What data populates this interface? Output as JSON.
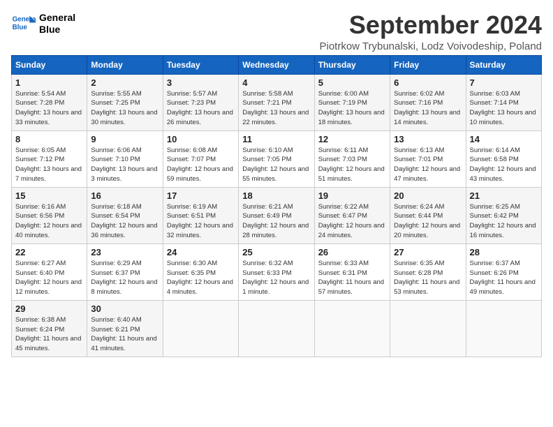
{
  "header": {
    "logo_line1": "General",
    "logo_line2": "Blue",
    "month": "September 2024",
    "location": "Piotrkow Trybunalski, Lodz Voivodeship, Poland"
  },
  "days_of_week": [
    "Sunday",
    "Monday",
    "Tuesday",
    "Wednesday",
    "Thursday",
    "Friday",
    "Saturday"
  ],
  "weeks": [
    [
      {
        "num": "1",
        "sunrise": "Sunrise: 5:54 AM",
        "sunset": "Sunset: 7:28 PM",
        "daylight": "Daylight: 13 hours and 33 minutes."
      },
      {
        "num": "2",
        "sunrise": "Sunrise: 5:55 AM",
        "sunset": "Sunset: 7:25 PM",
        "daylight": "Daylight: 13 hours and 30 minutes."
      },
      {
        "num": "3",
        "sunrise": "Sunrise: 5:57 AM",
        "sunset": "Sunset: 7:23 PM",
        "daylight": "Daylight: 13 hours and 26 minutes."
      },
      {
        "num": "4",
        "sunrise": "Sunrise: 5:58 AM",
        "sunset": "Sunset: 7:21 PM",
        "daylight": "Daylight: 13 hours and 22 minutes."
      },
      {
        "num": "5",
        "sunrise": "Sunrise: 6:00 AM",
        "sunset": "Sunset: 7:19 PM",
        "daylight": "Daylight: 13 hours and 18 minutes."
      },
      {
        "num": "6",
        "sunrise": "Sunrise: 6:02 AM",
        "sunset": "Sunset: 7:16 PM",
        "daylight": "Daylight: 13 hours and 14 minutes."
      },
      {
        "num": "7",
        "sunrise": "Sunrise: 6:03 AM",
        "sunset": "Sunset: 7:14 PM",
        "daylight": "Daylight: 13 hours and 10 minutes."
      }
    ],
    [
      {
        "num": "8",
        "sunrise": "Sunrise: 6:05 AM",
        "sunset": "Sunset: 7:12 PM",
        "daylight": "Daylight: 13 hours and 7 minutes."
      },
      {
        "num": "9",
        "sunrise": "Sunrise: 6:06 AM",
        "sunset": "Sunset: 7:10 PM",
        "daylight": "Daylight: 13 hours and 3 minutes."
      },
      {
        "num": "10",
        "sunrise": "Sunrise: 6:08 AM",
        "sunset": "Sunset: 7:07 PM",
        "daylight": "Daylight: 12 hours and 59 minutes."
      },
      {
        "num": "11",
        "sunrise": "Sunrise: 6:10 AM",
        "sunset": "Sunset: 7:05 PM",
        "daylight": "Daylight: 12 hours and 55 minutes."
      },
      {
        "num": "12",
        "sunrise": "Sunrise: 6:11 AM",
        "sunset": "Sunset: 7:03 PM",
        "daylight": "Daylight: 12 hours and 51 minutes."
      },
      {
        "num": "13",
        "sunrise": "Sunrise: 6:13 AM",
        "sunset": "Sunset: 7:01 PM",
        "daylight": "Daylight: 12 hours and 47 minutes."
      },
      {
        "num": "14",
        "sunrise": "Sunrise: 6:14 AM",
        "sunset": "Sunset: 6:58 PM",
        "daylight": "Daylight: 12 hours and 43 minutes."
      }
    ],
    [
      {
        "num": "15",
        "sunrise": "Sunrise: 6:16 AM",
        "sunset": "Sunset: 6:56 PM",
        "daylight": "Daylight: 12 hours and 40 minutes."
      },
      {
        "num": "16",
        "sunrise": "Sunrise: 6:18 AM",
        "sunset": "Sunset: 6:54 PM",
        "daylight": "Daylight: 12 hours and 36 minutes."
      },
      {
        "num": "17",
        "sunrise": "Sunrise: 6:19 AM",
        "sunset": "Sunset: 6:51 PM",
        "daylight": "Daylight: 12 hours and 32 minutes."
      },
      {
        "num": "18",
        "sunrise": "Sunrise: 6:21 AM",
        "sunset": "Sunset: 6:49 PM",
        "daylight": "Daylight: 12 hours and 28 minutes."
      },
      {
        "num": "19",
        "sunrise": "Sunrise: 6:22 AM",
        "sunset": "Sunset: 6:47 PM",
        "daylight": "Daylight: 12 hours and 24 minutes."
      },
      {
        "num": "20",
        "sunrise": "Sunrise: 6:24 AM",
        "sunset": "Sunset: 6:44 PM",
        "daylight": "Daylight: 12 hours and 20 minutes."
      },
      {
        "num": "21",
        "sunrise": "Sunrise: 6:25 AM",
        "sunset": "Sunset: 6:42 PM",
        "daylight": "Daylight: 12 hours and 16 minutes."
      }
    ],
    [
      {
        "num": "22",
        "sunrise": "Sunrise: 6:27 AM",
        "sunset": "Sunset: 6:40 PM",
        "daylight": "Daylight: 12 hours and 12 minutes."
      },
      {
        "num": "23",
        "sunrise": "Sunrise: 6:29 AM",
        "sunset": "Sunset: 6:37 PM",
        "daylight": "Daylight: 12 hours and 8 minutes."
      },
      {
        "num": "24",
        "sunrise": "Sunrise: 6:30 AM",
        "sunset": "Sunset: 6:35 PM",
        "daylight": "Daylight: 12 hours and 4 minutes."
      },
      {
        "num": "25",
        "sunrise": "Sunrise: 6:32 AM",
        "sunset": "Sunset: 6:33 PM",
        "daylight": "Daylight: 12 hours and 1 minute."
      },
      {
        "num": "26",
        "sunrise": "Sunrise: 6:33 AM",
        "sunset": "Sunset: 6:31 PM",
        "daylight": "Daylight: 11 hours and 57 minutes."
      },
      {
        "num": "27",
        "sunrise": "Sunrise: 6:35 AM",
        "sunset": "Sunset: 6:28 PM",
        "daylight": "Daylight: 11 hours and 53 minutes."
      },
      {
        "num": "28",
        "sunrise": "Sunrise: 6:37 AM",
        "sunset": "Sunset: 6:26 PM",
        "daylight": "Daylight: 11 hours and 49 minutes."
      }
    ],
    [
      {
        "num": "29",
        "sunrise": "Sunrise: 6:38 AM",
        "sunset": "Sunset: 6:24 PM",
        "daylight": "Daylight: 11 hours and 45 minutes."
      },
      {
        "num": "30",
        "sunrise": "Sunrise: 6:40 AM",
        "sunset": "Sunset: 6:21 PM",
        "daylight": "Daylight: 11 hours and 41 minutes."
      },
      null,
      null,
      null,
      null,
      null
    ]
  ]
}
